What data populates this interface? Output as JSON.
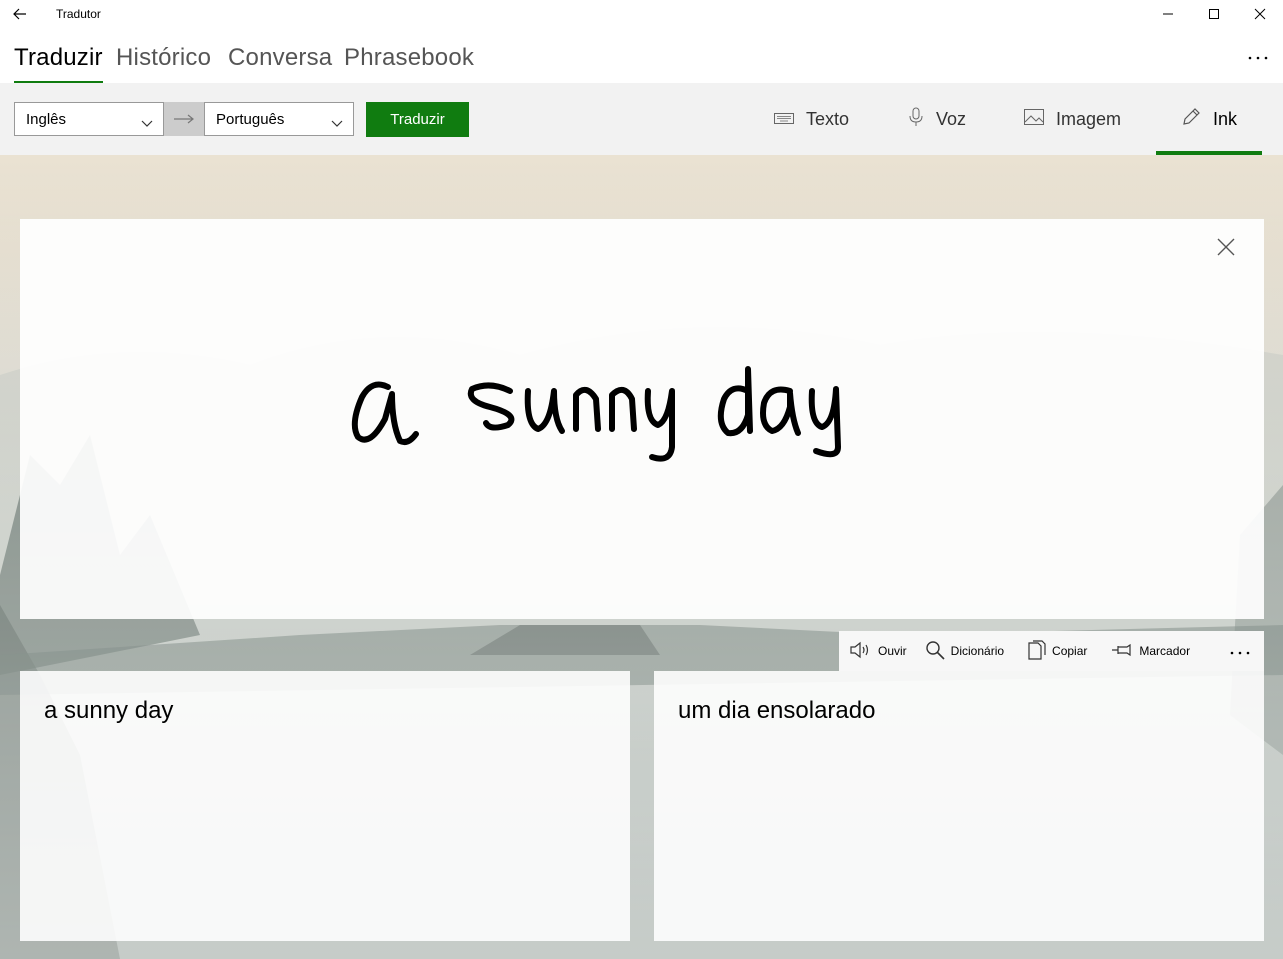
{
  "window": {
    "title": "Tradutor"
  },
  "pivot": {
    "tabs": [
      "Traduzir",
      "Histórico",
      "Conversa",
      "Phrasebook"
    ],
    "active": "Traduzir"
  },
  "toolbar": {
    "from_language": "Inglês",
    "to_language": "Português",
    "translate_label": "Traduzir",
    "modes": [
      "Texto",
      "Voz",
      "Imagem",
      "Ink"
    ],
    "active_mode": "Ink"
  },
  "ink": {
    "handwritten_text": "a sunny day"
  },
  "result_actions": {
    "listen": "Ouvir",
    "dictionary": "Dicionário",
    "copy": "Copiar",
    "bookmark": "Marcador"
  },
  "source_text": "a sunny day",
  "translated_text": "um dia ensolarado",
  "colors": {
    "accent": "#107c10"
  },
  "icons": {
    "back": "back-arrow-icon",
    "minimize": "minimize-icon",
    "maximize": "maximize-icon",
    "close": "close-icon",
    "more": "more-icon",
    "swap": "swap-arrow-icon",
    "text_mode": "keyboard-icon",
    "voice_mode": "microphone-icon",
    "image_mode": "image-icon",
    "ink_mode": "pen-icon",
    "speaker": "speaker-icon",
    "dictionary": "search-icon",
    "copy": "copy-icon",
    "bookmark": "pin-icon"
  }
}
